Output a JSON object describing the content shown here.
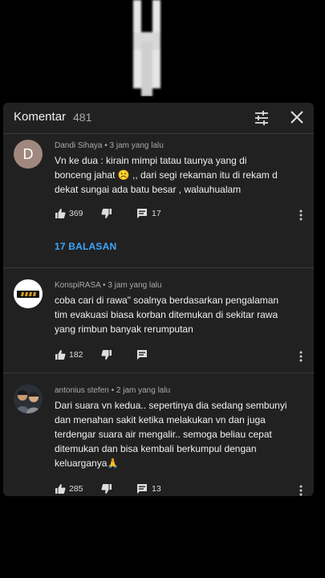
{
  "panel": {
    "title": "Komentar",
    "count": "481"
  },
  "comments": [
    {
      "avatar_letter": "D",
      "author_time": "Dandi Sihaya • 3 jam yang lalu",
      "lines": [
        "Vn ke dua : kirain mimpi tatau taunya yang di",
        "bonceng jahat ☹️ ,, dari segi rekaman itu di rekam d",
        "dekat sungai ada batu besar , walauhualam"
      ],
      "likes": "369",
      "replies": "17",
      "replies_label": "17 BALASAN"
    },
    {
      "author_time": "KonspiRASA • 3 jam yang lalu",
      "lines": [
        "coba cari di rawa\" soalnya berdasarkan pengalaman",
        "tim evakuasi biasa korban ditemukan di sekitar rawa",
        "yang rimbun banyak rerumputan"
      ],
      "likes": "182"
    },
    {
      "author_time": "antonius stefen • 2 jam yang lalu",
      "lines": [
        "Dari suara vn kedua.. sepertinya dia sedang sembunyi",
        "dan menahan sakit ketika melakukan vn dan juga",
        "terdengar suara air mengalir.. semoga beliau cepat",
        "ditemukan dan bisa kembali berkumpul dengan",
        "keluarganya🙏"
      ],
      "likes": "285",
      "replies": "13"
    }
  ],
  "colors": {
    "background": "#000000",
    "panel": "#212121",
    "text": "#f1f1f1",
    "meta": "#aaaaaa",
    "link": "#3ea6ff",
    "avatar_d": "#a1887f"
  },
  "icons": [
    "filter-icon",
    "close-icon",
    "like-icon",
    "dislike-icon",
    "reply-icon",
    "more-vert-icon"
  ]
}
